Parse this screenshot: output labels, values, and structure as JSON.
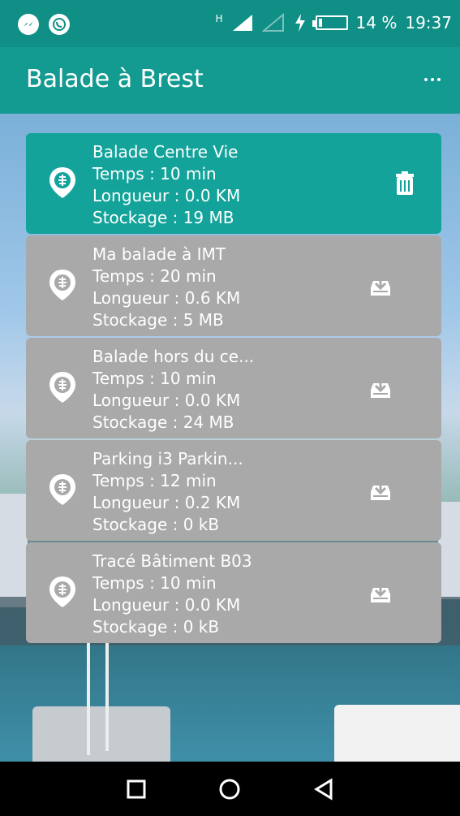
{
  "status": {
    "network": "H",
    "battery": "14 %",
    "battery_level": 0.14,
    "time": "19:37"
  },
  "app_bar": {
    "title": "Balade à Brest"
  },
  "walks": [
    {
      "name": "Balade Centre Vie",
      "temps": "Temps : 10 min",
      "longueur": "Longueur : 0.0 KM",
      "stockage": "Stockage : 19 MB",
      "downloaded": true
    },
    {
      "name": "Ma balade à IMT",
      "temps": "Temps : 20 min",
      "longueur": "Longueur : 0.6 KM",
      "stockage": "Stockage : 5 MB",
      "downloaded": false
    },
    {
      "name": "Balade hors du ce...",
      "temps": "Temps : 10 min",
      "longueur": "Longueur : 0.0 KM",
      "stockage": "Stockage : 24 MB",
      "downloaded": false
    },
    {
      "name": "Parking i3 Parkin...",
      "temps": "Temps : 12 min",
      "longueur": "Longueur : 0.2 KM",
      "stockage": "Stockage : 0 kB",
      "downloaded": false
    },
    {
      "name": "Tracé Bâtiment B03",
      "temps": "Temps : 10 min",
      "longueur": "Longueur : 0.0 KM",
      "stockage": "Stockage : 0 kB",
      "downloaded": false
    }
  ],
  "icons": {
    "pin": "map-pin-icon",
    "delete": "trash-icon",
    "download": "download-icon"
  },
  "colors": {
    "primary": "#139b91",
    "status_bar": "#0f8f86",
    "active_card": "#13a39a",
    "inactive_card": "#a9a9a9"
  }
}
